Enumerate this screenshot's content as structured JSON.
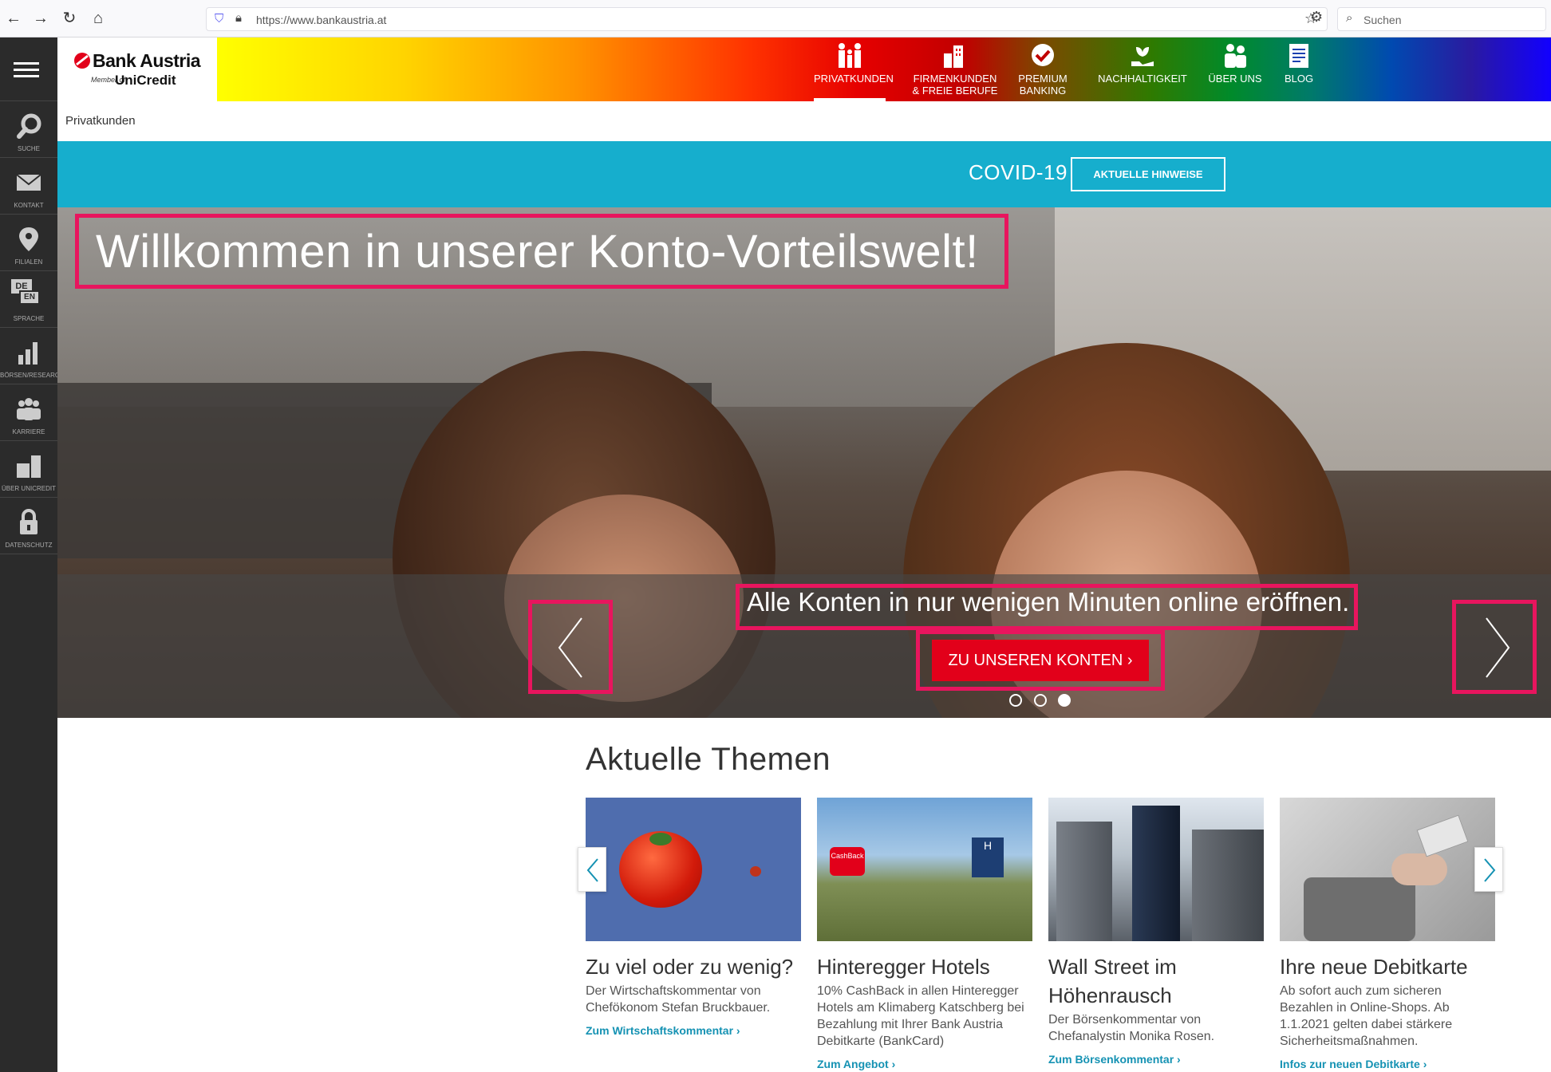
{
  "browser": {
    "url": "https://www.bankaustria.at",
    "search_placeholder": "Suchen"
  },
  "rail": {
    "items": [
      {
        "label": "SUCHE",
        "icon": "search-icon"
      },
      {
        "label": "KONTAKT",
        "icon": "mail-icon"
      },
      {
        "label": "FILIALEN",
        "icon": "location-pin-icon"
      },
      {
        "label": "SPRACHE",
        "icon": "language-icon",
        "icon_text_1": "DE",
        "icon_text_2": "EN"
      },
      {
        "label": "BÖRSEN/RESEARCH",
        "icon": "bar-chart-icon"
      },
      {
        "label": "KARRIERE",
        "icon": "people-icon"
      },
      {
        "label": "ÜBER UNICREDIT",
        "icon": "building-icon"
      },
      {
        "label": "DATENSCHUTZ",
        "icon": "lock-icon"
      }
    ]
  },
  "header": {
    "logo_main": "Bank Austria",
    "logo_member": "Member of",
    "logo_sub": "UniCredit",
    "nav": [
      {
        "label": "PRIVATKUNDEN",
        "icon": "family-icon",
        "active": true
      },
      {
        "label": "FIRMENKUNDEN\n& FREIE BERUFE",
        "icon": "buildings-icon",
        "active": false
      },
      {
        "label": "PREMIUM\nBANKING",
        "icon": "checkmark-badge-icon",
        "active": false
      },
      {
        "label": "NACHHALTIGKEIT",
        "icon": "plant-hand-icon",
        "active": false
      },
      {
        "label": "ÜBER UNS",
        "icon": "team-icon",
        "active": false
      },
      {
        "label": "BLOG",
        "icon": "document-icon",
        "active": false
      }
    ]
  },
  "breadcrumb": "Privatkunden",
  "covid": {
    "title": "COVID-19",
    "button": "AKTUELLE HINWEISE"
  },
  "hero": {
    "title": "Willkommen in unserer Konto-Vorteilswelt!",
    "subtitle": "Alle Konten in nur wenigen Minuten online eröffnen.",
    "cta": "ZU UNSEREN KONTEN ›",
    "slides": 3,
    "active_slide": 3
  },
  "themen": {
    "title": "Aktuelle Themen",
    "cards": [
      {
        "title": "Zu viel oder zu wenig?",
        "text": "Der Wirtschaftskommentar von Chefökonom Stefan Bruckbauer.",
        "link": "Zum Wirtschaftskommentar ›"
      },
      {
        "title": "Hinteregger Hotels",
        "text": "10% CashBack in allen Hinteregger Hotels am Klimaberg Katschberg bei Bezahlung mit Ihrer Bank Austria Debitkarte (BankCard)",
        "link": "Zum Angebot ›",
        "badge": "CashBack",
        "badge_2": "H"
      },
      {
        "title": "Wall Street im Höhenrausch",
        "text": "Der Börsenkommentar von Chefanalystin Monika Rosen.",
        "link": "Zum Börsenkommentar ›"
      },
      {
        "title": "Ihre neue Debitkarte",
        "text": "Ab sofort auch zum sicheren Bezahlen in Online-Shops. Ab 1.1.2021 gelten dabei stärkere Sicherheitsmaßnahmen.",
        "link": "Infos zur neuen Debitkarte ›"
      }
    ]
  },
  "colors": {
    "brand_red": "#e2001a",
    "covid_blue": "#16aecd",
    "link_blue": "#1592b3",
    "annotation_pink": "#e8155e"
  }
}
